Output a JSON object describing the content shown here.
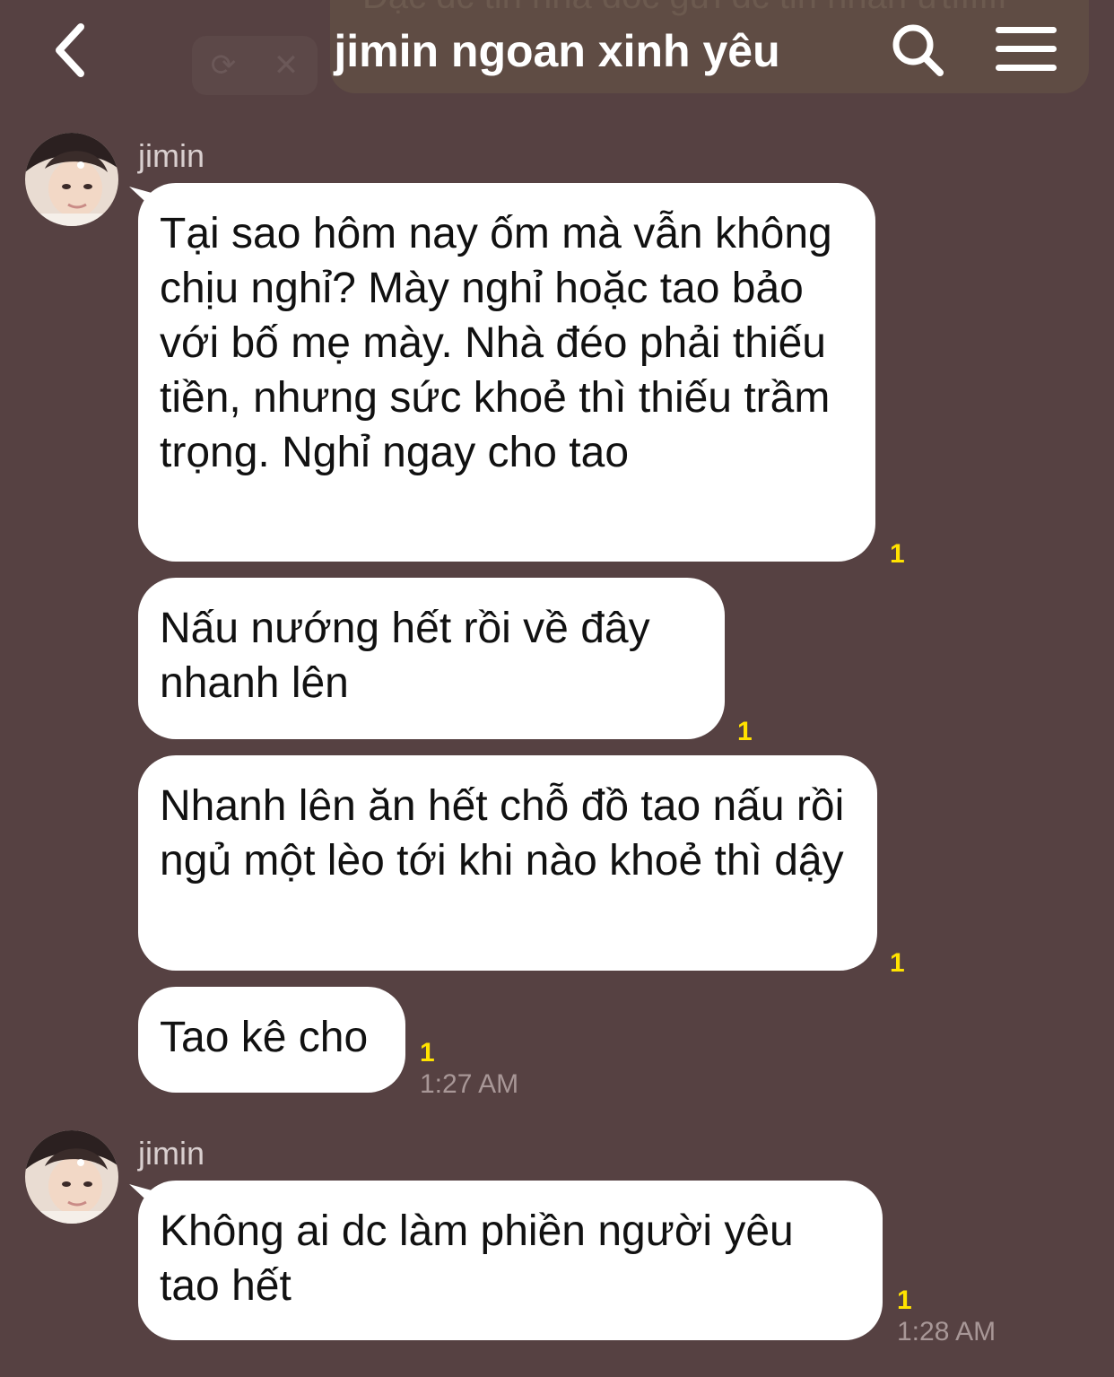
{
  "header": {
    "title": "jimin ngoan xinh yêu",
    "ghost_text": "Đặc dc tin nhà dốc gửi dc tin nhắn ưtffffff",
    "ghost_refresh": "⟳",
    "ghost_close": "✕"
  },
  "colors": {
    "background": "#564142",
    "bubble": "#ffffff",
    "unread": "#ffe200",
    "timestamp": "#a89797"
  },
  "groups": [
    {
      "sender": "jimin",
      "messages": [
        {
          "text": "Tại sao hôm nay ốm mà vẫn không chịu nghỉ? Mày nghỉ hoặc tao bảo với bố mẹ mày. Nhà đéo phải thiếu tiền, nhưng sức khoẻ thì thiếu trầm trọng. Nghỉ ngay cho tao",
          "unread": "1"
        },
        {
          "text": "Nấu nướng hết rồi về đây nhanh lên",
          "unread": "1"
        },
        {
          "text": "Nhanh lên ăn hết chỗ đồ tao nấu rồi ngủ một lèo tới khi nào khoẻ thì dậy",
          "unread": "1"
        },
        {
          "text": "Tao kê cho",
          "unread": "1",
          "time": "1:27 AM"
        }
      ]
    },
    {
      "sender": "jimin",
      "messages": [
        {
          "text": "Không ai dc làm phiền người yêu tao hết",
          "unread": "1",
          "time": "1:28 AM"
        }
      ]
    }
  ]
}
